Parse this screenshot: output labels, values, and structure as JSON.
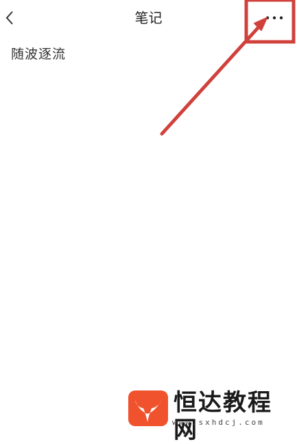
{
  "header": {
    "back_icon": "chevron-left-icon",
    "title": "笔记",
    "more_icon": "more-horizontal-icon"
  },
  "note": {
    "text": "随波逐流"
  },
  "annotation": {
    "color": "#d0413c"
  },
  "watermark": {
    "name": "恒达教程网",
    "url": "www.sxhdcj.com",
    "logo_color": "#f0522e"
  }
}
